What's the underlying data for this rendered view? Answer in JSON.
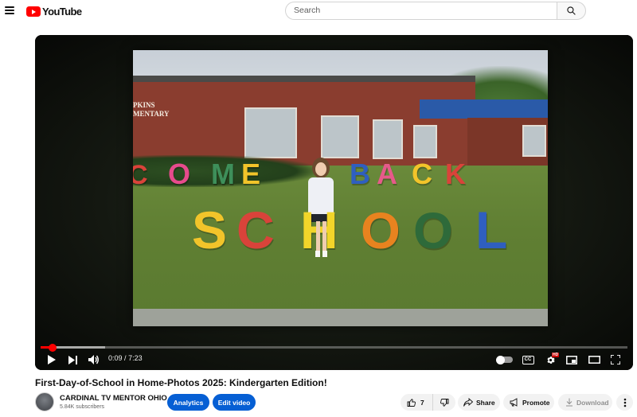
{
  "header": {
    "logo_text": "YouTube",
    "search_placeholder": "Search"
  },
  "player": {
    "photo_letters": {
      "row1": [
        "C",
        "O",
        "M",
        "E",
        "B",
        "A",
        "C",
        "K"
      ],
      "row2": [
        "S",
        "C",
        "H",
        "O",
        "O",
        "L"
      ]
    },
    "sign_lines": [
      "PKINS",
      "MENTARY"
    ],
    "time_current": "0:09",
    "time_separator": "/",
    "time_total": "7:23",
    "played_fraction": 0.02,
    "buffered_fraction": 0.11,
    "hd_badge": "HD",
    "cc_label": "CC"
  },
  "video": {
    "title": "First-Day-of-School in Home-Photos 2025: Kindergarten Edition!"
  },
  "channel": {
    "name": "CARDINAL TV MENTOR OHIO",
    "subscribers": "5.84K subscribers"
  },
  "actions": {
    "analytics_label": "Analytics",
    "edit_label": "Edit video",
    "like_count": "7",
    "share_label": "Share",
    "promote_label": "Promote",
    "download_label": "Download"
  },
  "colors": {
    "accent_red": "#ff0000",
    "brand_blue": "#065fd4",
    "letter_c": "#d9433a",
    "letter_o": "#e74b8c",
    "letter_m": "#3e8f5a",
    "letter_e": "#f2c42a",
    "letter_b": "#2f5fc0",
    "letter_a": "#e65a8a",
    "letter_c2": "#f2c42a",
    "letter_k": "#d9433a",
    "school_s": "#f2c42a",
    "school_c": "#d9433a",
    "school_h": "#f2d52a",
    "school_o1": "#e8831f",
    "school_o2": "#2e6a3a",
    "school_l": "#2f5fc0"
  }
}
